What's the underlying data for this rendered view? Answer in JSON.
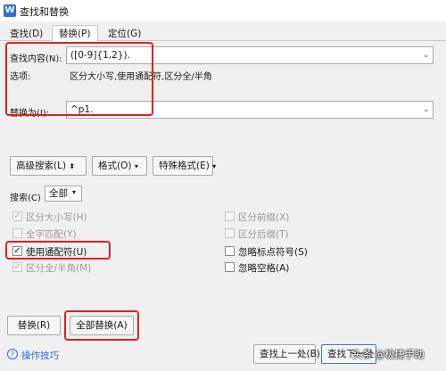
{
  "window": {
    "title": "查找和替换",
    "app_icon": "W"
  },
  "tabs": [
    {
      "label": "查找(D)"
    },
    {
      "label": "替换(P)"
    },
    {
      "label": "定位(G)"
    }
  ],
  "find": {
    "label": "查找内容(N):",
    "value": "([0-9]{1,2})."
  },
  "options": {
    "label": "选项:",
    "value": "区分大小写,使用通配符,区分全/半角"
  },
  "replace": {
    "label": "替换为(I):",
    "value": "^p1."
  },
  "buttons": {
    "advanced": "高级搜索(L)",
    "format": "格式(O)",
    "special": "特殊格式(E)",
    "replace": "替换(R)",
    "replace_all": "全部替换(A)",
    "find_prev": "查找上一处(B)",
    "find_next": "查找下一处"
  },
  "search": {
    "label": "搜索(C)",
    "value": "全部"
  },
  "checkboxes": {
    "match_case": "区分大小写(H)",
    "whole_word": "全字匹配(Y)",
    "wildcards": "使用通配符(U)",
    "width": "区分全/半角(M)",
    "prefix": "区分前缀(X)",
    "suffix": "区分后缀(T)",
    "ignore_punct": "忽略标点符号(S)",
    "ignore_space": "忽略空格(A)"
  },
  "help_link": "操作技巧",
  "watermark": "头条 @极捷手助"
}
